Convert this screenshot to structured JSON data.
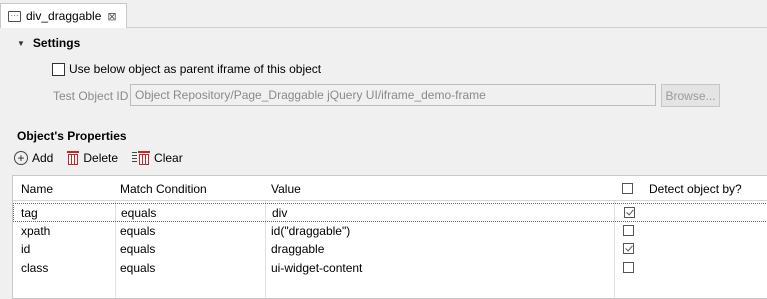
{
  "tab": {
    "title": "div_draggable",
    "close_glyph": "⊠",
    "icon": "object-icon"
  },
  "settings": {
    "title": "Settings",
    "parent_iframe_label": "Use below object as parent iframe of this object",
    "parent_iframe_checked": false,
    "test_object_label": "Test Object ID",
    "test_object_value": "Object Repository/Page_Draggable jQuery UI/iframe_demo-frame",
    "browse_label": "Browse..."
  },
  "properties": {
    "title": "Object's Properties",
    "toolbar": {
      "add_label": "Add",
      "delete_label": "Delete",
      "clear_label": "Clear"
    },
    "columns": [
      "Name",
      "Match Condition",
      "Value",
      "Detect object by?"
    ],
    "header_checkbox_checked": false,
    "rows": [
      {
        "name": "tag",
        "match": "equals",
        "value": "div",
        "detect": true
      },
      {
        "name": "xpath",
        "match": "equals",
        "value": "id(\"draggable\")",
        "detect": false
      },
      {
        "name": "id",
        "match": "equals",
        "value": "draggable",
        "detect": true
      },
      {
        "name": "class",
        "match": "equals",
        "value": "ui-widget-content",
        "detect": false
      }
    ]
  }
}
